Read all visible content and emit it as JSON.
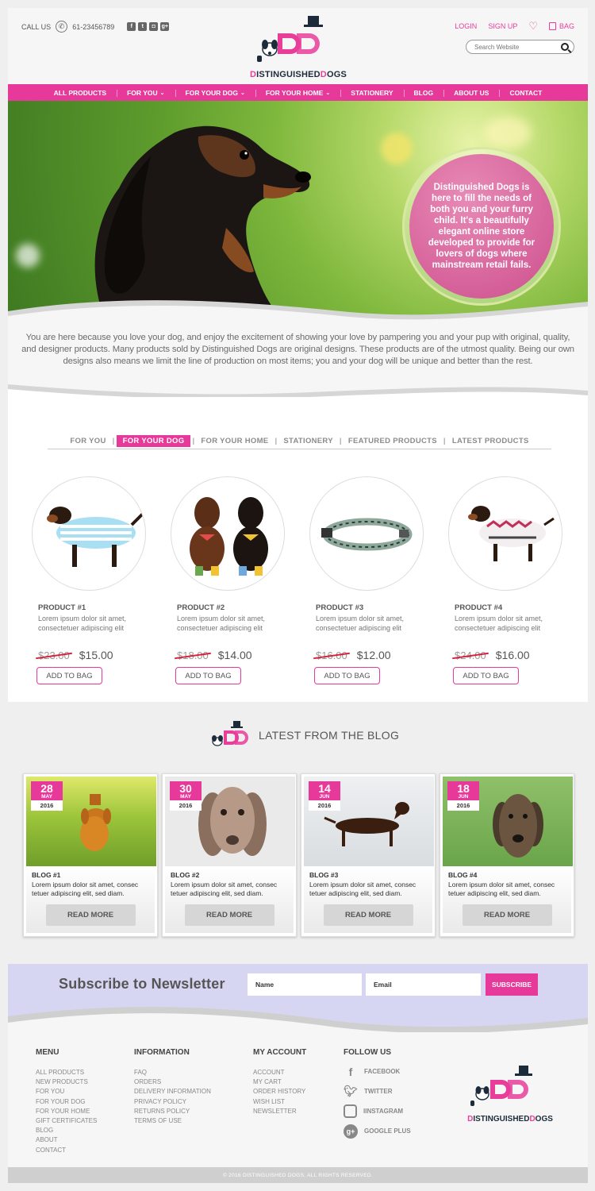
{
  "header": {
    "call_label": "CALL US",
    "phone": "61-23456789",
    "social_icons": [
      "facebook-icon",
      "twitter-icon",
      "instagram-icon",
      "google-plus-icon"
    ],
    "login": "LOGIN",
    "signup": "SIGN UP",
    "bag": "BAG",
    "search_placeholder": "Search Website",
    "logo_part1": "D",
    "logo_part2": "ISTINGUISHED",
    "logo_part3": "D",
    "logo_part4": "OGS"
  },
  "nav": {
    "items": [
      {
        "label": "ALL PRODUCTS"
      },
      {
        "label": "FOR YOU"
      },
      {
        "label": "FOR YOUR DOG"
      },
      {
        "label": "FOR YOUR HOME"
      },
      {
        "label": "STATIONERY"
      },
      {
        "label": "BLOG"
      },
      {
        "label": "ABOUT US"
      },
      {
        "label": "CONTACT"
      }
    ]
  },
  "hero": {
    "circle_text": "Distinguished Dogs is here to fill the needs of both you and your furry child. It's a beautifully elegant online store developed to provide for lovers of dogs where mainstream retail fails."
  },
  "intro": "You are here because you love your dog, and enjoy the excitement of showing your love by pampering you and your pup with original, quality, and designer products. Many products sold by Distinguished Dogs are original designs. These products are of the utmost quality. Being our own designs also means we limit the line of production on most items; you and your dog will be unique and better than the rest.",
  "tabs": {
    "items": [
      "FOR YOU",
      "FOR YOUR DOG",
      "FOR YOUR HOME",
      "STATIONERY",
      "FEATURED PRODUCTS",
      "LATEST PRODUCTS"
    ],
    "active": "FOR YOUR DOG"
  },
  "products": [
    {
      "title": "PRODUCT #1",
      "desc": "Lorem ipsum dolor sit amet, consectetuer adipiscing elit",
      "old_price": "$23.00",
      "price": "$15.00",
      "button": "ADD TO BAG"
    },
    {
      "title": "PRODUCT #2",
      "desc": "Lorem ipsum dolor sit amet, consectetuer adipiscing elit",
      "old_price": "$18.00",
      "price": "$14.00",
      "button": "ADD TO BAG"
    },
    {
      "title": "PRODUCT #3",
      "desc": "Lorem ipsum dolor sit amet, consectetuer adipiscing elit",
      "old_price": "$16.00",
      "price": "$12.00",
      "button": "ADD TO BAG"
    },
    {
      "title": "PRODUCT #4",
      "desc": "Lorem ipsum dolor sit amet, consectetuer adipiscing elit",
      "old_price": "$24.00",
      "price": "$16.00",
      "button": "ADD TO BAG"
    }
  ],
  "blog": {
    "heading": "LATEST FROM THE BLOG",
    "posts": [
      {
        "day": "28",
        "month": "MAY",
        "year": "2016",
        "title": "BLOG #1",
        "desc": "Lorem ipsum dolor sit amet, consec tetuer adipiscing elit, sed diam.",
        "button": "READ MORE"
      },
      {
        "day": "30",
        "month": "MAY",
        "year": "2016",
        "title": "BLOG #2",
        "desc": "Lorem ipsum dolor sit amet, consec tetuer adipiscing elit, sed diam.",
        "button": "READ MORE"
      },
      {
        "day": "14",
        "month": "JUN",
        "year": "2016",
        "title": "BLOG #3",
        "desc": "Lorem ipsum dolor sit amet, consec tetuer adipiscing elit, sed diam.",
        "button": "READ MORE"
      },
      {
        "day": "18",
        "month": "JUN",
        "year": "2016",
        "title": "BLOG #4",
        "desc": "Lorem ipsum dolor sit amet, consec tetuer adipiscing elit, sed diam.",
        "button": "READ MORE"
      }
    ]
  },
  "newsletter": {
    "title": "Subscribe to Newsletter",
    "name_placeholder": "Name",
    "email_placeholder": "Email",
    "button": "SUBSCRIBE"
  },
  "footer": {
    "menu": {
      "heading": "MENU",
      "links": [
        "ALL PRODUCTS",
        "NEW PRODUCTS",
        "FOR YOU",
        "FOR YOUR DOG",
        "FOR YOUR HOME",
        "GIFT CERTIFICATES",
        "BLOG",
        "ABOUT",
        "CONTACT"
      ]
    },
    "information": {
      "heading": "INFORMATION",
      "links": [
        "FAQ",
        "ORDERS",
        "DELIVERY INFORMATION",
        "PRIVACY POLICY",
        "RETURNS POLICY",
        "TERMS OF USE"
      ]
    },
    "account": {
      "heading": "MY ACCOUNT",
      "links": [
        "ACCOUNT",
        "MY CART",
        "ORDER HISTORY",
        "WISH LIST",
        "NEWSLETTER"
      ]
    },
    "follow": {
      "heading": "FOLLOW US",
      "links": [
        "FACEBOOK",
        "TWITTER",
        "IINSTAGRAM",
        "GOOGLE PLUS"
      ]
    },
    "copyright": "© 2016 DISTINGUISHED DOGS. ALL RIGHTS RESERVED."
  },
  "colors": {
    "brand_pink": "#e6399a",
    "dark_navy": "#1c2b3a",
    "newsletter_bg": "#d7d6f2"
  }
}
